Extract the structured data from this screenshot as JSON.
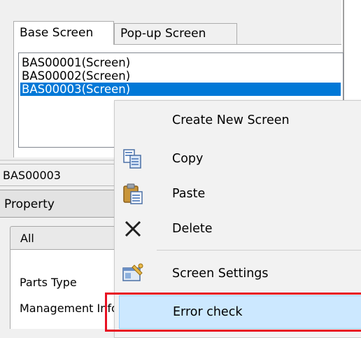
{
  "tabs": [
    {
      "label": "Base Screen",
      "active": true
    },
    {
      "label": "Pop-up Screen",
      "active": false
    }
  ],
  "screen_list": [
    {
      "label": "BAS00001(Screen)",
      "selected": false
    },
    {
      "label": "BAS00002(Screen)",
      "selected": false
    },
    {
      "label": "BAS00003(Screen)",
      "selected": true
    }
  ],
  "name_box": "BAS00003",
  "property_header": "Property",
  "property_tab": "All",
  "property_rows": [
    "Parts Type",
    "Management Info"
  ],
  "context_menu": {
    "items": [
      {
        "label": "Create New Screen",
        "icon": "none"
      },
      {
        "label": "Copy",
        "icon": "copy-icon"
      },
      {
        "label": "Paste",
        "icon": "paste-icon"
      },
      {
        "label": "Delete",
        "icon": "delete-icon"
      },
      {
        "label": "Screen Settings",
        "icon": "screen-settings-icon"
      },
      {
        "label": "Error check",
        "icon": "none",
        "highlighted": true
      }
    ]
  },
  "colors": {
    "selection": "#0078d7",
    "menu_hover": "#cce8ff",
    "callout": "#e81123"
  }
}
